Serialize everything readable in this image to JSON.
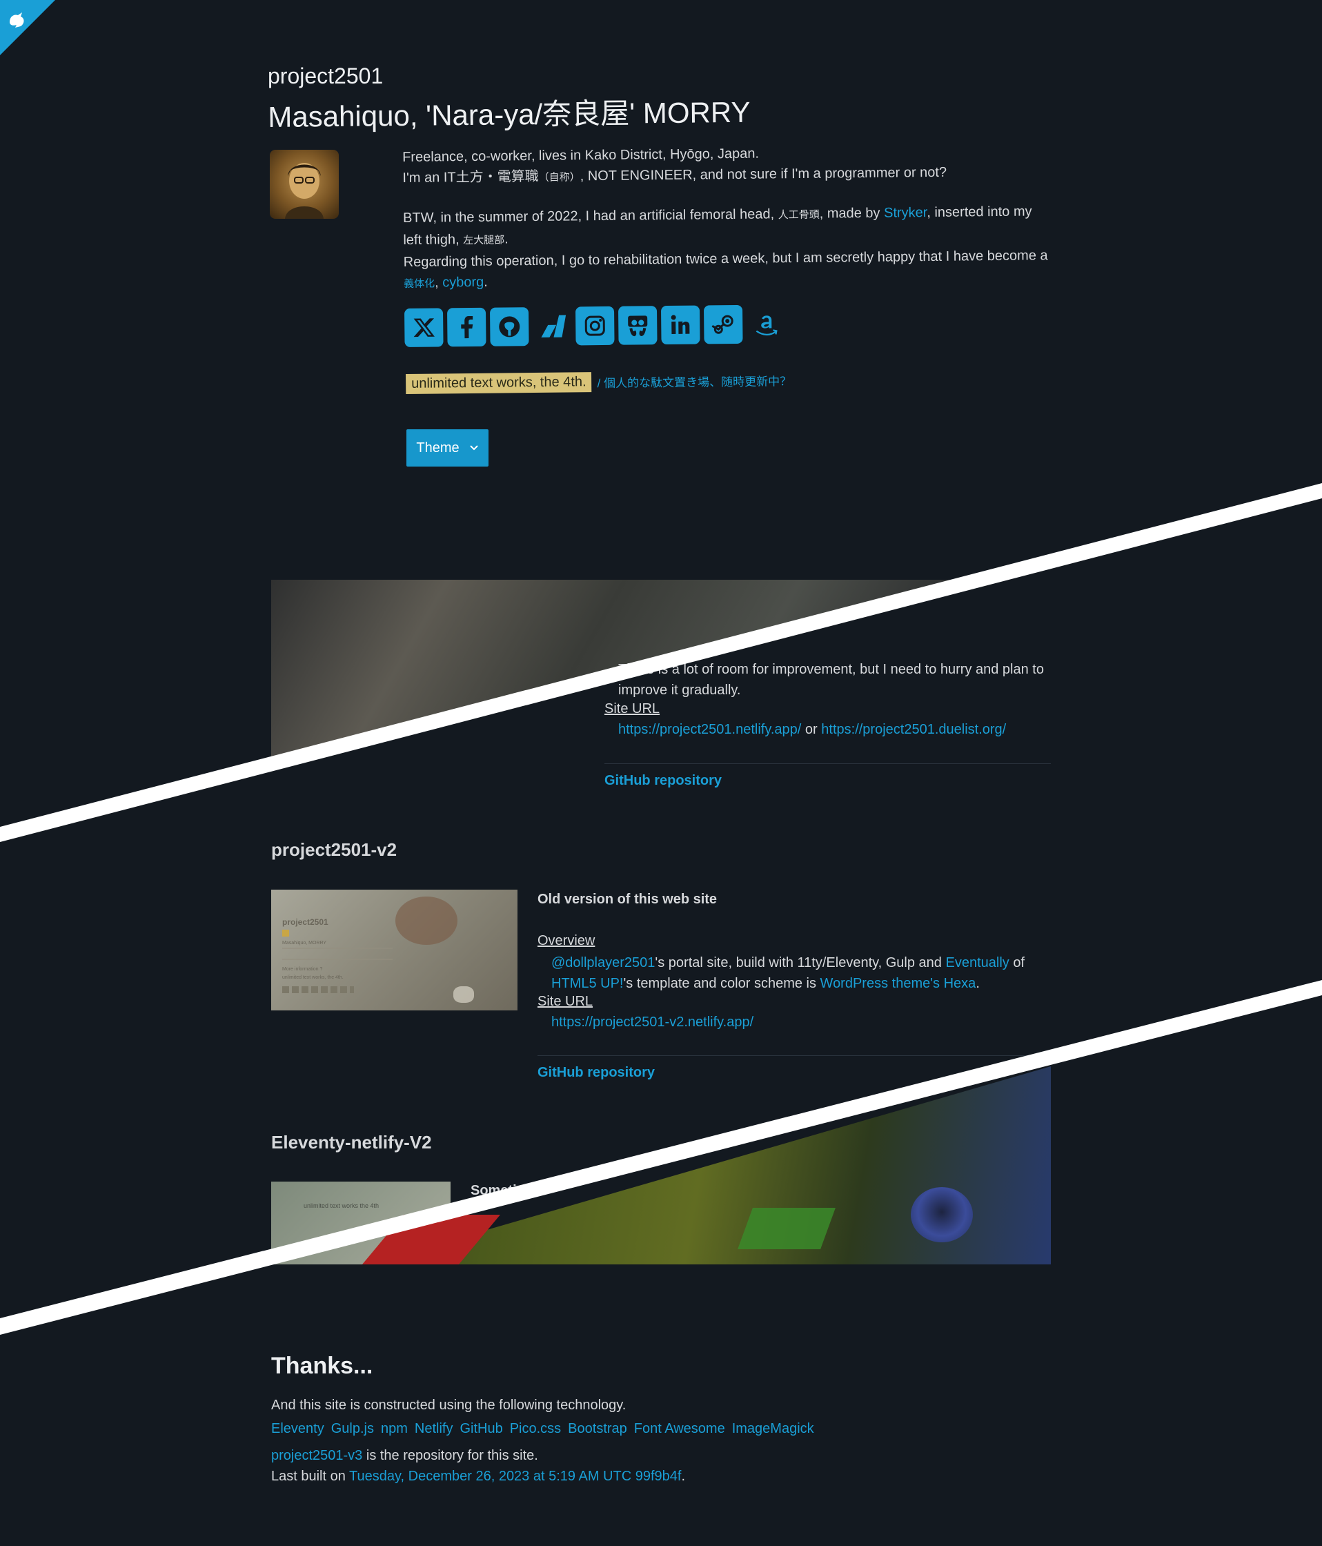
{
  "header": {
    "site_title": "project2501",
    "name": "Masahiquo, 'Nara-ya/奈良屋' MORRY"
  },
  "bio": {
    "line1": "Freelance, co-worker, lives in Kako District, Hyōgo, Japan.",
    "line2_a": "I'm an IT土方・電算職",
    "line2_small": "（自称）",
    "line2_b": ", NOT ENGINEER, and not sure if I'm a programmer or not?",
    "line3_a": "BTW, in the summer of 2022, I had an artificial femoral head,",
    "line3_small": "人工骨頭",
    "line3_b": ", made by",
    "line3_link": "Stryker",
    "line3_c": ", inserted into my left thigh,",
    "line3_small2": "左大腿部",
    "line3_d": ".",
    "line4": "Regarding this operation, I go to rehabilitation twice a week, but I am secretly happy that I have become a",
    "line4_small": "義体化",
    "line4_sep": ",",
    "line4_link": "cyborg",
    "line4_end": "."
  },
  "social": [
    {
      "icon": "x-twitter-icon"
    },
    {
      "icon": "facebook-icon"
    },
    {
      "icon": "github-icon"
    },
    {
      "icon": "zenn-icon"
    },
    {
      "icon": "instagram-icon"
    },
    {
      "icon": "slideshare-icon"
    },
    {
      "icon": "linkedin-icon"
    },
    {
      "icon": "steam-icon"
    },
    {
      "icon": "amazon-icon"
    }
  ],
  "utw": {
    "badge": "unlimited text works, the 4th.",
    "desc": "/ 個人的な駄文置き場、随時更新中？"
  },
  "theme_button": {
    "label": "Theme"
  },
  "project1": {
    "improve": "There is a lot of room for improvement, but I need to hurry and plan to improve it gradually.",
    "site_label": "Site URL",
    "url1": "https://project2501.netlify.app/",
    "or": "or",
    "url2": "https://project2501.duelist.org/",
    "github": "GitHub repository"
  },
  "project2": {
    "title": "project2501-v2",
    "subtitle": "Old version of this web site",
    "overview_label": "Overview",
    "overview_link1": "@dollplayer2501",
    "overview_a": "'s portal site, build with 11ty/Eleventy, Gulp and",
    "overview_link2": "Eventually",
    "overview_b": "of",
    "overview_link3": "HTML5 UP!",
    "overview_c": "'s template and color scheme is",
    "overview_link4": "WordPress theme's Hexa",
    "overview_d": ".",
    "site_label": "Site URL",
    "url": "https://project2501-v2.netlify.app/",
    "github": "GitHub repository",
    "thumb": {
      "title": "project2501",
      "name": "Masahiquo, MORRY",
      "more": "More information ?",
      "utw": "unlimited text works, the 4th."
    }
  },
  "project3": {
    "title": "Eleventy-netlify-V2",
    "subtitle": "Someti",
    "thumb_text": "unlimited text works the 4th"
  },
  "thanks": {
    "title": "Thanks...",
    "text": "And this site is constructed using the following technology.",
    "tech": [
      "Eleventy",
      "Gulp.js",
      "npm",
      "Netlify",
      "GitHub",
      "Pico.css",
      "Bootstrap",
      "Font Awesome",
      "ImageMagick"
    ],
    "repo_link": "project2501-v3",
    "repo_text": " is the repository for this site.",
    "built_prefix": "Last built on ",
    "built_link": "Tuesday, December 26, 2023 at 5:19 AM UTC 99f9b4f",
    "built_end": "."
  },
  "colors": {
    "background": "#131920",
    "accent": "#1a9fd6",
    "badge": "#d9c479",
    "divider": "#ffffff"
  }
}
